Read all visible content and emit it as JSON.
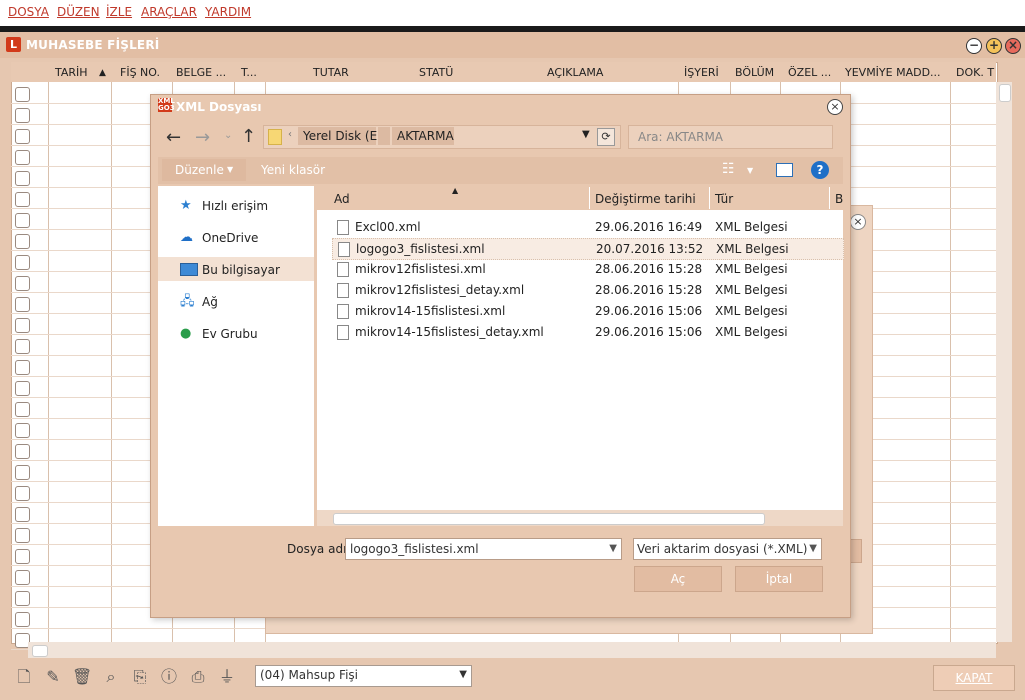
{
  "menu": {
    "items": [
      "DOSYA",
      "DÜZEN",
      "İZLE",
      "ARAÇLAR",
      "YARDIM"
    ]
  },
  "window": {
    "title": "MUHASEBE FİŞLERİ"
  },
  "grid": {
    "columns": [
      "TARİH",
      "FİŞ NO.",
      "BELGE ...",
      "T...",
      "TUTAR",
      "STATÜ",
      "AÇIKLAMA",
      "İŞYERİ",
      "BÖLÜM",
      "ÖZEL ...",
      "YEVMİYE MADD...",
      "DOK. T"
    ]
  },
  "bottom": {
    "fis_type": "(04) Mahsup Fişi",
    "close_label": "KAPAT"
  },
  "dialog": {
    "title": "XML Dosyası",
    "breadcrumb": [
      "Yerel Disk (E:)",
      "AKTARMA"
    ],
    "search_placeholder": "Ara: AKTARMA",
    "organize_label": "Düzenle",
    "new_folder_label": "Yeni klasör",
    "nav_items": [
      "Hızlı erişim",
      "OneDrive",
      "Bu bilgisayar",
      "Ağ",
      "Ev Grubu"
    ],
    "file_columns": [
      "Ad",
      "Değiştirme tarihi",
      "Tür",
      "B"
    ],
    "files": [
      {
        "name": "Excl00.xml",
        "date": "29.06.2016 16:49",
        "type": "XML Belgesi"
      },
      {
        "name": "logogo3_fislistesi.xml",
        "date": "20.07.2016 13:52",
        "type": "XML Belgesi"
      },
      {
        "name": "mikrov12fislistesi.xml",
        "date": "28.06.2016 15:28",
        "type": "XML Belgesi"
      },
      {
        "name": "mikrov12fislistesi_detay.xml",
        "date": "28.06.2016 15:28",
        "type": "XML Belgesi"
      },
      {
        "name": "mikrov14-15fislistesi.xml",
        "date": "29.06.2016 15:06",
        "type": "XML Belgesi"
      },
      {
        "name": "mikrov14-15fislistesi_detay.xml",
        "date": "29.06.2016 15:06",
        "type": "XML Belgesi"
      }
    ],
    "filename_label": "Dosya adı:",
    "filename_value": "logogo3_fislistesi.xml",
    "filter_value": "Veri aktarim dosyasi (*.XML)",
    "open_label": "Aç",
    "cancel_label": "İptal"
  }
}
